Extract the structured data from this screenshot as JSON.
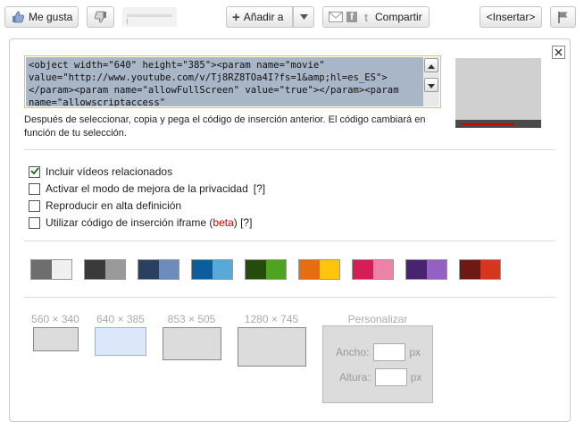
{
  "toolbar": {
    "like_label": "Me gusta",
    "add_label": "Añadir a",
    "share_label": "Compartir",
    "share_fb": "f",
    "share_tw": "t",
    "embed_label": "<Insertar>"
  },
  "embed": {
    "code": "<object width=\"640\" height=\"385\"><param name=\"movie\" value=\"http://www.youtube.com/v/Tj8RZ8TOa4I?fs=1&amp;hl=es_ES\"></param><param name=\"allowFullScreen\" value=\"true\"></param><param name=\"allowscriptaccess\"",
    "help_text": "Después de seleccionar, copia y pega el código de inserción anterior. El código cambiará en función de tu selección."
  },
  "options": [
    {
      "label": "Incluir vídeos relacionados",
      "checked": true
    },
    {
      "label": "Activar el modo de mejora de la privacidad",
      "suffix": "[?]",
      "checked": false
    },
    {
      "label": "Reproducir en alta definición",
      "checked": false
    },
    {
      "label": "Utilizar código de inserción iframe (",
      "beta": "beta",
      "suffix": ") [?]",
      "checked": false
    }
  ],
  "colors": [
    [
      "#6e6e6e",
      "#f0f0f0"
    ],
    [
      "#3a3a3a",
      "#9a9a9a"
    ],
    [
      "#2b4060",
      "#6c8cbc"
    ],
    [
      "#0c5d9b",
      "#59a9d8"
    ],
    [
      "#244d0c",
      "#4ea41e"
    ],
    [
      "#e86c10",
      "#ffc50d"
    ],
    [
      "#d41e55",
      "#ec82a5"
    ],
    [
      "#4a2370",
      "#9460c4"
    ],
    [
      "#6e1a12",
      "#d6351f"
    ]
  ],
  "sizes": [
    {
      "label": "560 × 340",
      "selected": false
    },
    {
      "label": "640 × 385",
      "selected": true
    },
    {
      "label": "853 × 505",
      "selected": false
    },
    {
      "label": "1280 × 745",
      "selected": false
    }
  ],
  "custom": {
    "title": "Personalizar",
    "width_label": "Ancho:",
    "height_label": "Altura:",
    "unit": "px"
  }
}
